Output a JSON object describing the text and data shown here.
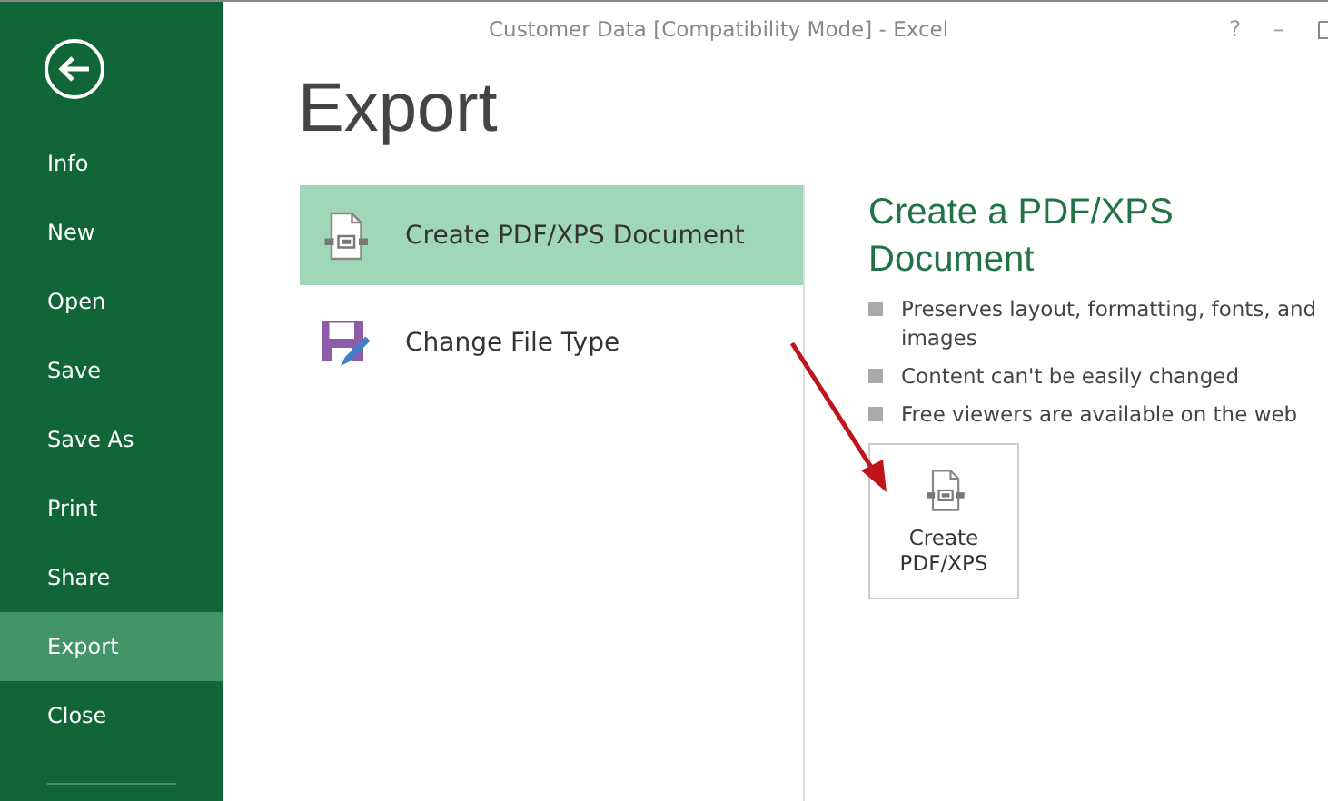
{
  "window": {
    "title": "Customer Data  [Compatibility Mode] - Excel",
    "controls": [
      "?",
      "–"
    ]
  },
  "sidebar": {
    "items": [
      {
        "label": "Info",
        "selected": false
      },
      {
        "label": "New",
        "selected": false
      },
      {
        "label": "Open",
        "selected": false
      },
      {
        "label": "Save",
        "selected": false
      },
      {
        "label": "Save As",
        "selected": false
      },
      {
        "label": "Print",
        "selected": false
      },
      {
        "label": "Share",
        "selected": false
      },
      {
        "label": "Export",
        "selected": true
      },
      {
        "label": "Close",
        "selected": false
      }
    ]
  },
  "page": {
    "title": "Export",
    "options": [
      {
        "label": "Create PDF/XPS Document",
        "kind": "pdf",
        "selected": true
      },
      {
        "label": "Change File Type",
        "kind": "filetype",
        "selected": false
      }
    ],
    "detail": {
      "heading": "Create a PDF/XPS Document",
      "bullets": [
        "Preserves layout, formatting, fonts, and images",
        "Content can't be easily changed",
        "Free viewers are available on the web"
      ],
      "button": "Create PDF/XPS"
    }
  }
}
